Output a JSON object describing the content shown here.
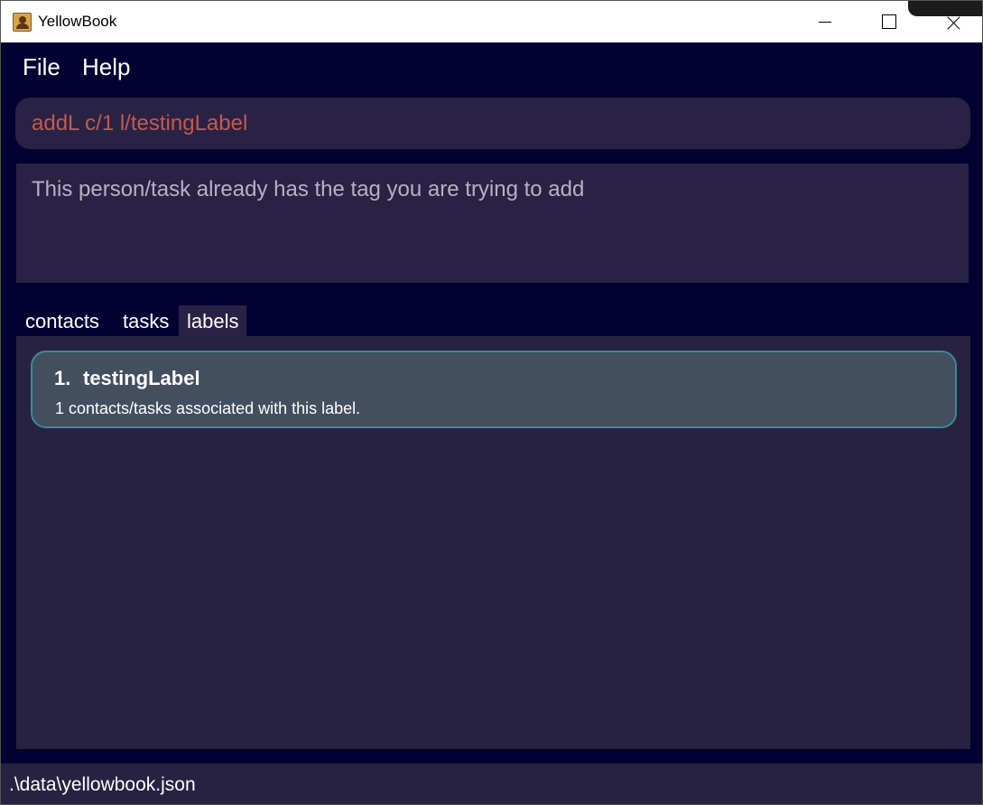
{
  "window": {
    "title": "YellowBook",
    "icon": "contact-book-icon"
  },
  "menu": {
    "file": "File",
    "help": "Help"
  },
  "command": {
    "value": "addL c/1 l/testingLabel"
  },
  "result": {
    "message": "This person/task already has the tag you are trying to add"
  },
  "tabs": [
    {
      "label": "contacts",
      "selected": false
    },
    {
      "label": "tasks",
      "selected": false
    },
    {
      "label": "labels",
      "selected": true
    }
  ],
  "labels": [
    {
      "index": "1.",
      "name": "testingLabel",
      "description": "1 contacts/tasks associated with this label."
    }
  ],
  "status": {
    "path": ".\\data\\yellowbook.json"
  },
  "colors": {
    "background": "#030131",
    "panel": "#2a2245",
    "card": "#434e5e",
    "card_border": "#3a8a95",
    "command_text": "#c25a4f"
  }
}
